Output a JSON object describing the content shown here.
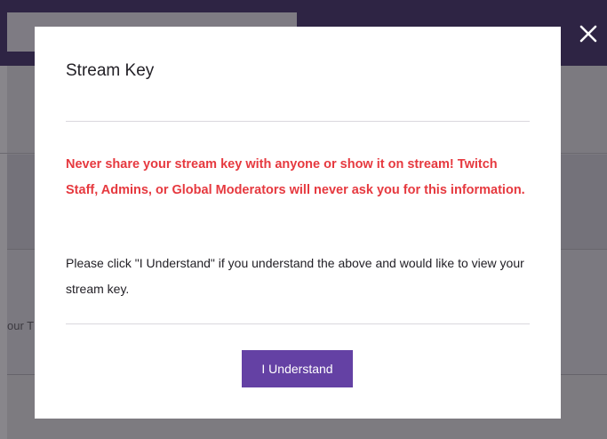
{
  "background": {
    "row_text_fragment": "our T"
  },
  "overlay": {
    "close_icon": "close-icon"
  },
  "modal": {
    "title": "Stream Key",
    "warning": "Never share your stream key with anyone or show it on stream! Twitch Staff, Admins, or Global Moderators will never ask you for this information.",
    "info": "Please click \"I Understand\" if you understand the above and would like to view your stream key.",
    "confirm_button_label": "I Understand"
  },
  "colors": {
    "accent": "#6441a4",
    "warning_text": "#e6393f",
    "overlay_dim": "#7d7b80"
  }
}
